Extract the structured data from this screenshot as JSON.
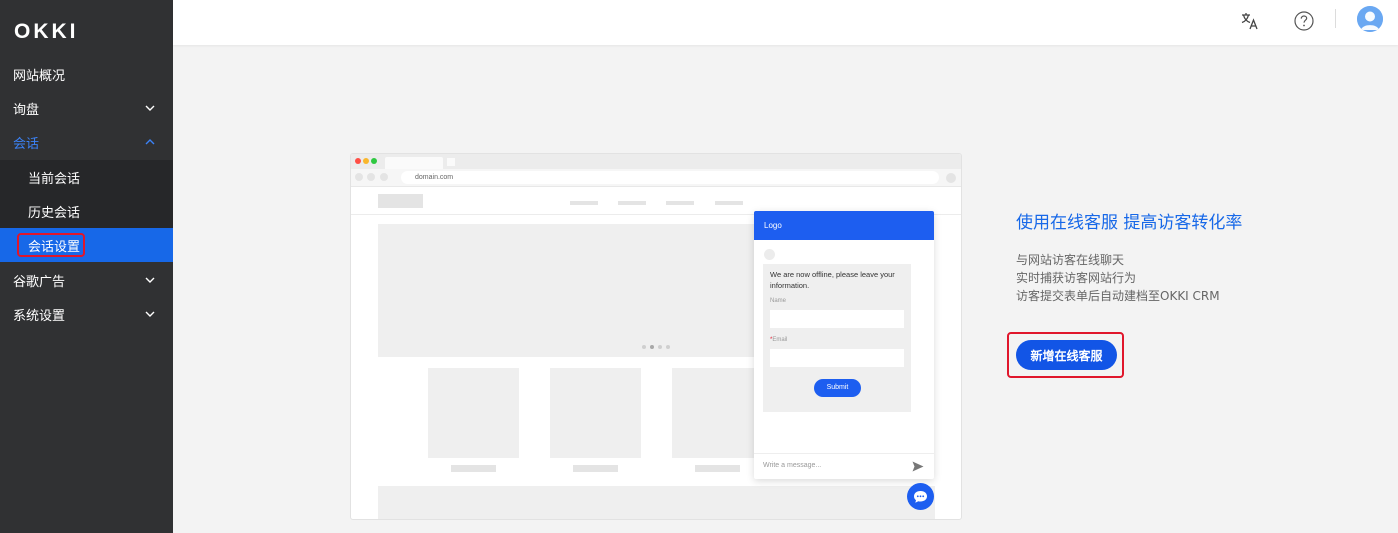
{
  "app": {
    "logo_text": "OKKI"
  },
  "sidebar": {
    "items": [
      {
        "label": "网站概况"
      },
      {
        "label": "询盘"
      },
      {
        "label": "会话",
        "children": [
          {
            "label": "当前会话"
          },
          {
            "label": "历史会话"
          },
          {
            "label": "会话设置",
            "active": true
          }
        ]
      },
      {
        "label": "谷歌广告"
      },
      {
        "label": "系统设置"
      }
    ]
  },
  "topbar": {
    "icons": [
      "translate-icon",
      "help-icon",
      "avatar"
    ]
  },
  "illustration": {
    "url": "domain.com",
    "chat_header": "Logo",
    "offline_message": "We are now offline, please leave your information.",
    "name_label": "Name",
    "email_label": "Email",
    "required_mark": "*",
    "submit_label": "Submit",
    "input_placeholder": "Write a message..."
  },
  "promo": {
    "title": "使用在线客服 提高访客转化率",
    "lines": [
      "与网站访客在线聊天",
      "实时捕获访客网站行为",
      "访客提交表单后自动建档至OKKI CRM"
    ],
    "cta_label": "新增在线客服"
  },
  "colors": {
    "primary": "#1768e8",
    "sidebar_bg": "#303133",
    "highlight": "#e0162b"
  }
}
